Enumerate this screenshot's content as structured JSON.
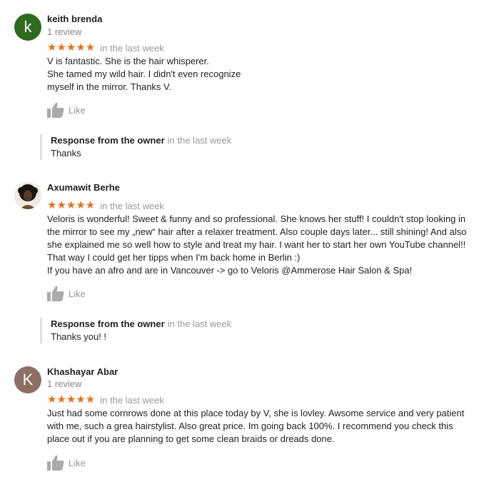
{
  "reviews": [
    {
      "avatar_letter": "k",
      "name": "keith brenda",
      "review_count": "1 review",
      "stars": "★★★★★",
      "date": "in the last week",
      "text_lines": [
        "V is fantastic. She is the hair whisperer.",
        "She tamed my wild hair. I didn't even recognize",
        "myself in the mirror. Thanks V."
      ],
      "like_label": "Like",
      "response": {
        "title": "Response from the owner",
        "date": "in the last week",
        "text": "Thanks"
      }
    },
    {
      "name": "Axumawit Berhe",
      "stars": "★★★★★",
      "date": "in the last week",
      "text_lines": [
        "Veloris is wonderful! Sweet & funny and so professional. She knows her stuff! I couldn't stop looking in",
        "the mirror to see my „new“ hair after a relaxer treatment. Also couple days later... still shining! And also",
        "she explained me so well how to style and treat my hair. I want her to start her own YouTube channel!!",
        "That way I could get her tipps when I'm back home in Berlin :)",
        "If you have an afro and are in Vancouver -> go to Veloris @Ammerose Hair Salon & Spa!"
      ],
      "like_label": "Like",
      "response": {
        "title": "Response from the owner",
        "date": "in the last week",
        "text": "Thanks you! !"
      }
    },
    {
      "avatar_letter": "K",
      "name": "Khashayar Abar",
      "review_count": "1 review",
      "stars": "★★★★★",
      "date": "in the last week",
      "text_lines": [
        "Just had some cornrows done at this place today by V, she is lovley. Awsome service and very patient",
        "with me, such a grea hairstylist. Also great price. Im going back 100%. I recommend you check this",
        "place out if you are planning to get some clean braids or dreads done."
      ],
      "like_label": "Like"
    }
  ],
  "colors": {
    "star": "#e7711b",
    "muted": "#999999",
    "avatar_green": "#2e6b1e",
    "avatar_brown": "#8d6e63"
  }
}
